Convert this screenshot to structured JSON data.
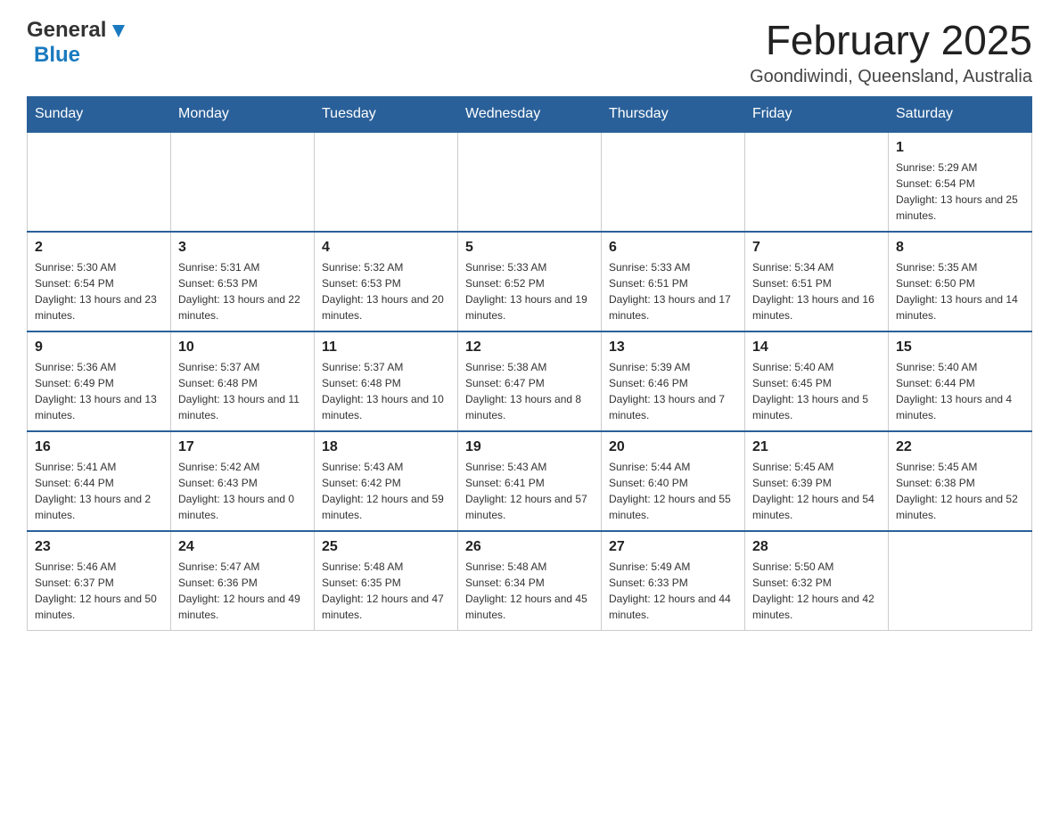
{
  "header": {
    "logo_general": "General",
    "logo_blue": "Blue",
    "month_title": "February 2025",
    "location": "Goondiwindi, Queensland, Australia"
  },
  "days_of_week": [
    "Sunday",
    "Monday",
    "Tuesday",
    "Wednesday",
    "Thursday",
    "Friday",
    "Saturday"
  ],
  "weeks": [
    {
      "days": [
        {
          "number": "",
          "info": ""
        },
        {
          "number": "",
          "info": ""
        },
        {
          "number": "",
          "info": ""
        },
        {
          "number": "",
          "info": ""
        },
        {
          "number": "",
          "info": ""
        },
        {
          "number": "",
          "info": ""
        },
        {
          "number": "1",
          "info": "Sunrise: 5:29 AM\nSunset: 6:54 PM\nDaylight: 13 hours and 25 minutes."
        }
      ]
    },
    {
      "days": [
        {
          "number": "2",
          "info": "Sunrise: 5:30 AM\nSunset: 6:54 PM\nDaylight: 13 hours and 23 minutes."
        },
        {
          "number": "3",
          "info": "Sunrise: 5:31 AM\nSunset: 6:53 PM\nDaylight: 13 hours and 22 minutes."
        },
        {
          "number": "4",
          "info": "Sunrise: 5:32 AM\nSunset: 6:53 PM\nDaylight: 13 hours and 20 minutes."
        },
        {
          "number": "5",
          "info": "Sunrise: 5:33 AM\nSunset: 6:52 PM\nDaylight: 13 hours and 19 minutes."
        },
        {
          "number": "6",
          "info": "Sunrise: 5:33 AM\nSunset: 6:51 PM\nDaylight: 13 hours and 17 minutes."
        },
        {
          "number": "7",
          "info": "Sunrise: 5:34 AM\nSunset: 6:51 PM\nDaylight: 13 hours and 16 minutes."
        },
        {
          "number": "8",
          "info": "Sunrise: 5:35 AM\nSunset: 6:50 PM\nDaylight: 13 hours and 14 minutes."
        }
      ]
    },
    {
      "days": [
        {
          "number": "9",
          "info": "Sunrise: 5:36 AM\nSunset: 6:49 PM\nDaylight: 13 hours and 13 minutes."
        },
        {
          "number": "10",
          "info": "Sunrise: 5:37 AM\nSunset: 6:48 PM\nDaylight: 13 hours and 11 minutes."
        },
        {
          "number": "11",
          "info": "Sunrise: 5:37 AM\nSunset: 6:48 PM\nDaylight: 13 hours and 10 minutes."
        },
        {
          "number": "12",
          "info": "Sunrise: 5:38 AM\nSunset: 6:47 PM\nDaylight: 13 hours and 8 minutes."
        },
        {
          "number": "13",
          "info": "Sunrise: 5:39 AM\nSunset: 6:46 PM\nDaylight: 13 hours and 7 minutes."
        },
        {
          "number": "14",
          "info": "Sunrise: 5:40 AM\nSunset: 6:45 PM\nDaylight: 13 hours and 5 minutes."
        },
        {
          "number": "15",
          "info": "Sunrise: 5:40 AM\nSunset: 6:44 PM\nDaylight: 13 hours and 4 minutes."
        }
      ]
    },
    {
      "days": [
        {
          "number": "16",
          "info": "Sunrise: 5:41 AM\nSunset: 6:44 PM\nDaylight: 13 hours and 2 minutes."
        },
        {
          "number": "17",
          "info": "Sunrise: 5:42 AM\nSunset: 6:43 PM\nDaylight: 13 hours and 0 minutes."
        },
        {
          "number": "18",
          "info": "Sunrise: 5:43 AM\nSunset: 6:42 PM\nDaylight: 12 hours and 59 minutes."
        },
        {
          "number": "19",
          "info": "Sunrise: 5:43 AM\nSunset: 6:41 PM\nDaylight: 12 hours and 57 minutes."
        },
        {
          "number": "20",
          "info": "Sunrise: 5:44 AM\nSunset: 6:40 PM\nDaylight: 12 hours and 55 minutes."
        },
        {
          "number": "21",
          "info": "Sunrise: 5:45 AM\nSunset: 6:39 PM\nDaylight: 12 hours and 54 minutes."
        },
        {
          "number": "22",
          "info": "Sunrise: 5:45 AM\nSunset: 6:38 PM\nDaylight: 12 hours and 52 minutes."
        }
      ]
    },
    {
      "days": [
        {
          "number": "23",
          "info": "Sunrise: 5:46 AM\nSunset: 6:37 PM\nDaylight: 12 hours and 50 minutes."
        },
        {
          "number": "24",
          "info": "Sunrise: 5:47 AM\nSunset: 6:36 PM\nDaylight: 12 hours and 49 minutes."
        },
        {
          "number": "25",
          "info": "Sunrise: 5:48 AM\nSunset: 6:35 PM\nDaylight: 12 hours and 47 minutes."
        },
        {
          "number": "26",
          "info": "Sunrise: 5:48 AM\nSunset: 6:34 PM\nDaylight: 12 hours and 45 minutes."
        },
        {
          "number": "27",
          "info": "Sunrise: 5:49 AM\nSunset: 6:33 PM\nDaylight: 12 hours and 44 minutes."
        },
        {
          "number": "28",
          "info": "Sunrise: 5:50 AM\nSunset: 6:32 PM\nDaylight: 12 hours and 42 minutes."
        },
        {
          "number": "",
          "info": ""
        }
      ]
    }
  ]
}
